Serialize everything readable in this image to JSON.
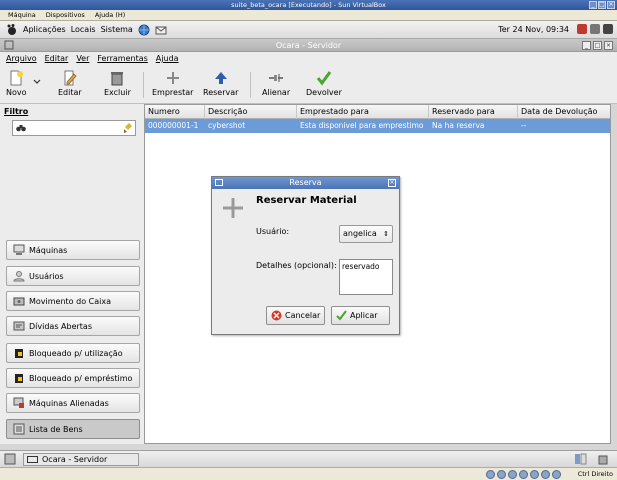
{
  "vbox": {
    "title": "suite_beta_ocara [Executando] - Sun VirtualBox",
    "menu": [
      "Máquina",
      "Dispositivos",
      "Ajuda (H)"
    ],
    "host_key": "Ctrl Direito"
  },
  "panel": {
    "menu": [
      "Aplicações",
      "Locais",
      "Sistema"
    ],
    "clock": "Ter 24 Nov, 09:34"
  },
  "window": {
    "title": "Ocara - Servidor",
    "menu": [
      "Arquivo",
      "Editar",
      "Ver",
      "Ferramentas",
      "Ajuda"
    ]
  },
  "toolbar": {
    "novo": "Novo",
    "editar": "Editar",
    "excluir": "Excluir",
    "emprestar": "Emprestar",
    "reservar": "Reservar",
    "alienar": "Alienar",
    "devolver": "Devolver"
  },
  "sidebar": {
    "filter_label": "Filtro",
    "items": [
      {
        "label": "Máquinas",
        "icon": "computer-icon"
      },
      {
        "label": "Usuários",
        "icon": "users-icon"
      },
      {
        "label": "Movimento do Caixa",
        "icon": "cash-icon"
      },
      {
        "label": "Dívidas Abertas",
        "icon": "debts-icon"
      },
      {
        "label": "Bloqueado p/ utilização",
        "icon": "lock-icon"
      },
      {
        "label": "Bloqueado p/ empréstimo",
        "icon": "lock-icon"
      },
      {
        "label": "Máquinas Alienadas",
        "icon": "alienated-icon"
      },
      {
        "label": "Lista de Bens",
        "icon": "list-icon"
      }
    ]
  },
  "table": {
    "columns": [
      "Numero",
      "Descrição",
      "Emprestado para",
      "Reservado para",
      "Data de Devolução"
    ],
    "rows": [
      [
        "000000001-1",
        "cybershot",
        "Esta disponivel para emprestimo",
        "Na ha reserva",
        "--"
      ]
    ]
  },
  "dialog": {
    "title": "Reserva",
    "heading": "Reservar Material",
    "user_label": "Usuário:",
    "user_value": "angelica",
    "details_label": "Detalhes (opcional):",
    "details_value": "reservado",
    "cancel": "Cancelar",
    "apply": "Aplicar"
  },
  "taskbar": {
    "task": "Ocara - Servidor"
  }
}
